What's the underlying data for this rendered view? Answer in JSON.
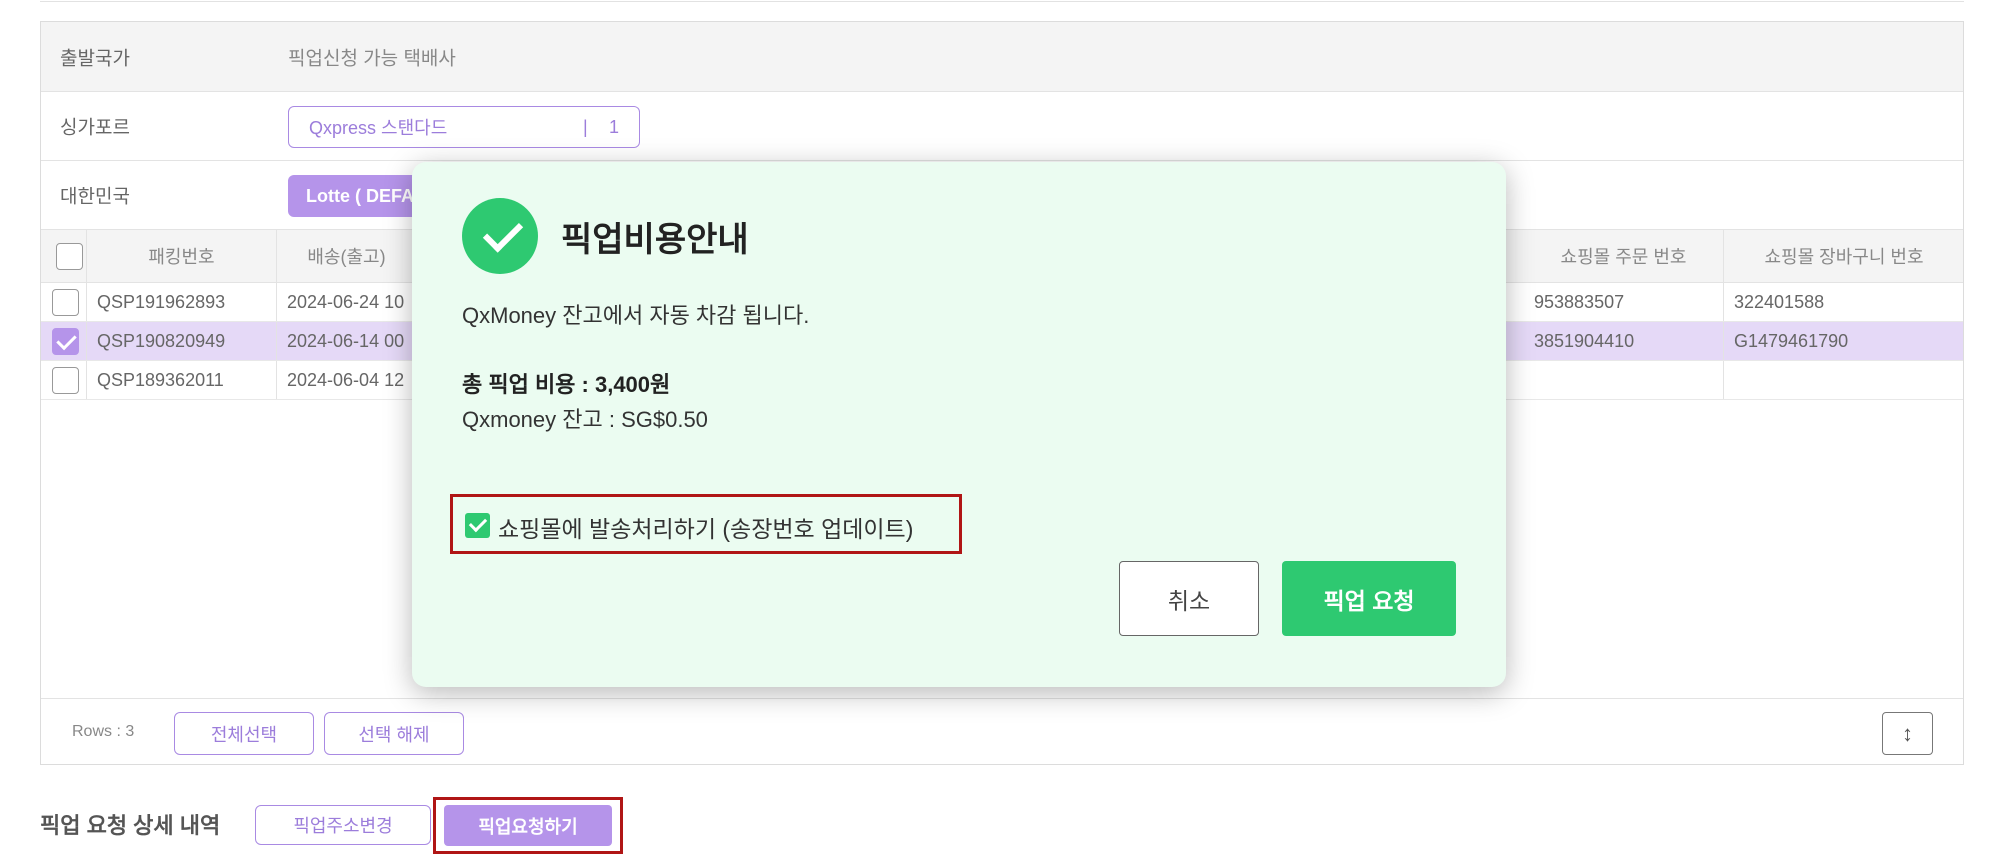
{
  "carrier_table": {
    "header": {
      "country": "출발국가",
      "carrier": "픽업신청 가능 택배사"
    },
    "rows": [
      {
        "country": "싱가포르",
        "carrier_chip": "Qxpress 스탠다드",
        "separator": "|",
        "count": "1"
      },
      {
        "country": "대한민국",
        "carrier_chip": "Lotte ( DEFAULT )"
      }
    ]
  },
  "orders_grid": {
    "columns": [
      "패킹번호",
      "배송(출고)",
      "쇼핑몰 주문 번호",
      "쇼핑몰 장바구니 번호"
    ],
    "rows": [
      {
        "packing_no": "QSP191962893",
        "ship_date": "2024-06-24 10",
        "order_no": "953883507",
        "cart_no": "322401588",
        "selected": false
      },
      {
        "packing_no": "QSP190820949",
        "ship_date": "2024-06-14 00",
        "order_no": "3851904410",
        "cart_no": "G1479461790",
        "selected": true
      },
      {
        "packing_no": "QSP189362011",
        "ship_date": "2024-06-04 12",
        "order_no": "",
        "cart_no": "",
        "selected": false
      }
    ],
    "footer": {
      "rows_label": "Rows : 3",
      "select_all": "전체선택",
      "deselect": "선택 해제",
      "expand_icon": "expand-vertical-icon"
    }
  },
  "bottom": {
    "title": "픽업 요청 상세 내역",
    "change_address": "픽업주소변경",
    "request_pickup": "픽업요청하기"
  },
  "modal": {
    "icon": "check-circle-icon",
    "title": "픽업비용안내",
    "description": "QxMoney 잔고에서 자동 차감 됩니다.",
    "total_label": "총 픽업 비용 : 3,400원",
    "balance_label": "Qxmoney 잔고 : SG$0.50",
    "option_label": "쇼핑몰에 발송처리하기 (송장번호 업데이트)",
    "option_checked": true,
    "cancel": "취소",
    "confirm": "픽업 요청"
  },
  "colors": {
    "accent_purple": "#b594ea",
    "accent_green": "#2ec971",
    "highlight_red": "#b01515",
    "modal_bg": "#ebfcf1"
  }
}
